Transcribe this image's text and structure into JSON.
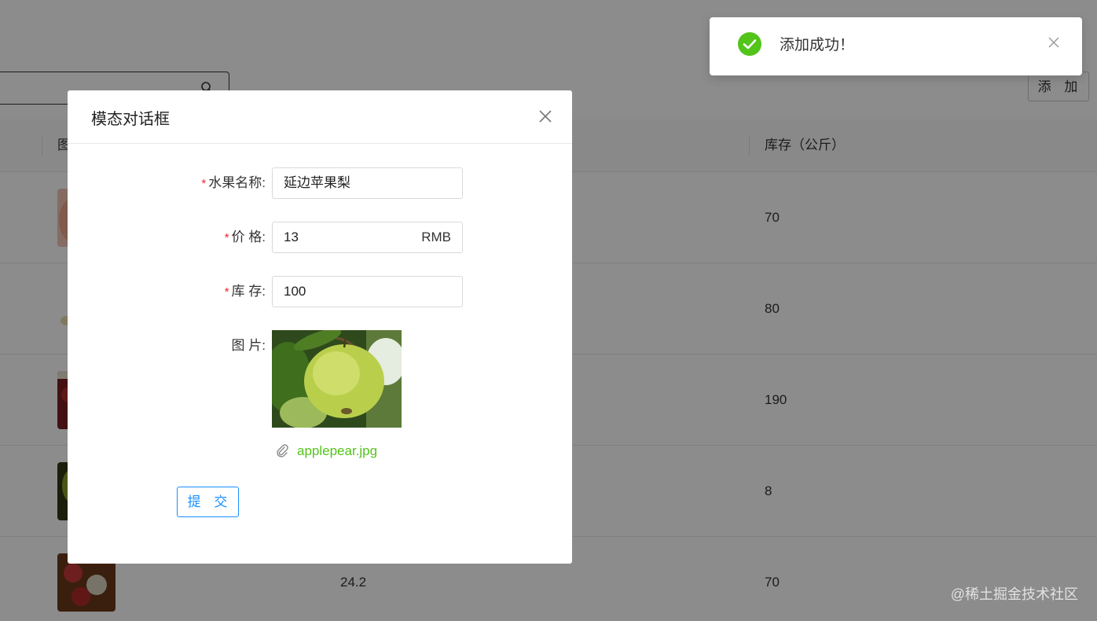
{
  "toast": {
    "text": "添加成功！",
    "success_color": "#52c41a"
  },
  "toolbar": {
    "add_label": "添 加",
    "search_icon": "search-icon"
  },
  "table": {
    "headers": [
      "图",
      "库存（公斤）"
    ],
    "rows": [
      {
        "price": "",
        "stock": "70"
      },
      {
        "price": "",
        "stock": "80"
      },
      {
        "price": "",
        "stock": "190"
      },
      {
        "price": "",
        "stock": "8"
      },
      {
        "price": "24.2",
        "stock": "70"
      }
    ]
  },
  "modal": {
    "title": "模态对话框",
    "fields": {
      "name": {
        "label": "水果名称",
        "value": "延边苹果梨"
      },
      "price": {
        "label": "价 格",
        "value": "13",
        "suffix": "RMB"
      },
      "stock": {
        "label": "库 存",
        "value": "100"
      },
      "image": {
        "label": "图 片",
        "file_name": "applepear.jpg"
      }
    },
    "submit_label": "提 交",
    "link_color": "#52c41a",
    "primary_color": "#1890ff"
  },
  "watermark": "@稀土掘金技术社区"
}
